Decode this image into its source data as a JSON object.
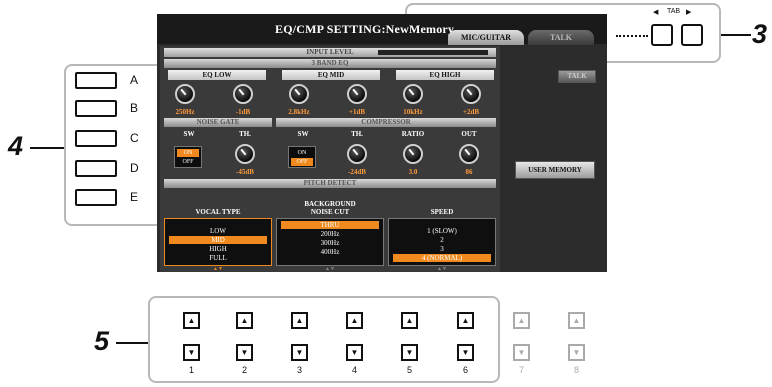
{
  "screen": {
    "title": "EQ/CMP SETTING:NewMemory",
    "tabs": [
      {
        "label": "MIC/GUITAR",
        "active": true
      },
      {
        "label": "TALK",
        "active": false
      }
    ],
    "section_input_level": "INPUT LEVEL",
    "section_3band_eq": "3 BAND EQ",
    "eq_groups": [
      {
        "label": "EQ LOW",
        "knobs": [
          "250Hz",
          "-1dB"
        ]
      },
      {
        "label": "EQ MID",
        "knobs": [
          "2.8kHz",
          "+1dB"
        ]
      },
      {
        "label": "EQ HIGH",
        "knobs": [
          "10kHz",
          "+2dB"
        ]
      }
    ],
    "section_noise_gate": "NOISE GATE",
    "section_compressor": "COMPRESSOR",
    "noise_gate": {
      "sw_label": "SW",
      "sw_on": "ON",
      "sw_off": "OFF",
      "sw_selected": "ON",
      "th_label": "TH.",
      "th_value": "-45dB"
    },
    "compressor": {
      "sw_label": "SW",
      "sw_on": "ON",
      "sw_off": "OFF",
      "sw_selected": "OFF",
      "th_label": "TH.",
      "th_value": "-24dB",
      "ratio_label": "RATIO",
      "ratio_value": "3.0",
      "out_label": "OUT",
      "out_value": "86"
    },
    "section_pitch_detect": "PITCH DETECT",
    "vocal_type": {
      "title": "VOCAL TYPE",
      "options": [
        "LOW",
        "MID",
        "HIGH",
        "FULL"
      ],
      "selected": "MID"
    },
    "noise_cut": {
      "title_line1": "BACKGROUND",
      "title_line2": "NOISE CUT",
      "options": [
        "THRU",
        "200Hz",
        "300Hz",
        "400Hz"
      ],
      "selected": "THRU"
    },
    "speed": {
      "title": "SPEED",
      "options": [
        "1 (SLOW)",
        "2",
        "3",
        "4 (NORMAL)"
      ],
      "selected": "4 (NORMAL)"
    },
    "side_buttons": {
      "talk": "TALK",
      "user_memory": "USER MEMORY"
    },
    "scroll_arrows": "▲▼"
  },
  "left_buttons": [
    "A",
    "B",
    "C",
    "D",
    "E"
  ],
  "bottom_buttons": [
    "1",
    "2",
    "3",
    "4",
    "5",
    "6",
    "7",
    "8"
  ],
  "bottom_arrows": {
    "up": "▲",
    "down": "▼"
  },
  "tab_hw": {
    "label": "TAB",
    "left": "◀",
    "right": "▶"
  },
  "callouts": {
    "three": "3",
    "four": "4",
    "five": "5"
  },
  "colors": {
    "accent": "#f08a1e",
    "knob_value": "#ff9a3a"
  }
}
